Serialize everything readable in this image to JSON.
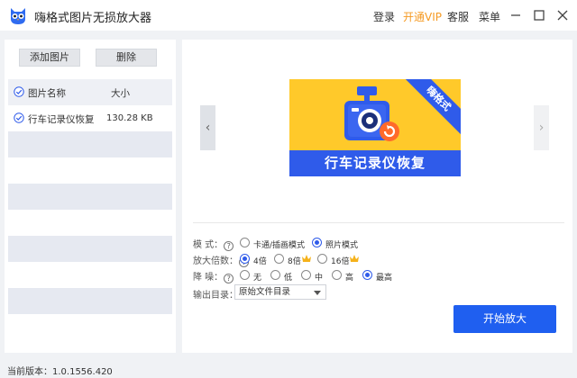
{
  "titlebar": {
    "app_title": "嗨格式图片无损放大器",
    "login": "登录",
    "vip": "开通VIP",
    "service": "客服",
    "menu": "菜单"
  },
  "left": {
    "add_button": "添加图片",
    "delete_button": "删除",
    "columns": {
      "name": "图片名称",
      "size": "大小"
    },
    "files": [
      {
        "name": "行车记录仪恢复",
        "size": "130.28 KB"
      }
    ]
  },
  "preview": {
    "ribbon": "嗨格式",
    "banner": "行车记录仪恢复"
  },
  "options": {
    "mode": {
      "label": "模 式：",
      "choices": [
        "卡通/插画模式",
        "照片模式"
      ],
      "selected": 1
    },
    "scale": {
      "label": "放大倍数：",
      "choices": [
        "4倍",
        "8倍",
        "16倍"
      ],
      "selected": 0
    },
    "denoise": {
      "label": "降 噪：",
      "choices": [
        "无",
        "低",
        "中",
        "高",
        "最高"
      ],
      "selected": 4
    },
    "output": {
      "label": "输出目录：",
      "value": "原始文件目录"
    }
  },
  "start_button": "开始放大",
  "version": "当前版本：1.0.1556.420",
  "colors": {
    "accent": "#1f5ff0",
    "vip": "#f59a23",
    "preview_bg": "#ffc92a"
  }
}
